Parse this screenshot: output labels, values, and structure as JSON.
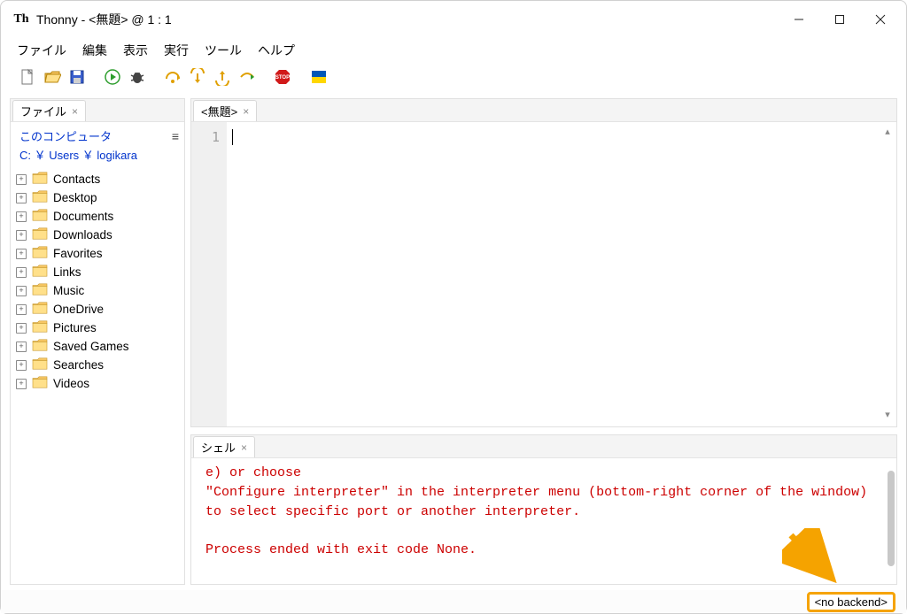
{
  "window": {
    "title": "Thonny  -  <無題>  @  1 : 1",
    "app_icon_label": "Th"
  },
  "menubar": [
    "ファイル",
    "編集",
    "表示",
    "実行",
    "ツール",
    "ヘルプ"
  ],
  "sidebar": {
    "tab_label": "ファイル",
    "computer_label": "このコンピュータ",
    "path": "C: ￥ Users ￥ logikara",
    "folders": [
      "Contacts",
      "Desktop",
      "Documents",
      "Downloads",
      "Favorites",
      "Links",
      "Music",
      "OneDrive",
      "Pictures",
      "Saved Games",
      "Searches",
      "Videos"
    ]
  },
  "editor": {
    "tab_label": "<無題>",
    "line_number": "1"
  },
  "shell": {
    "tab_label": "シェル",
    "lines": [
      "e) or choose",
      "\"Configure interpreter\" in the interpreter menu (bottom-right corner of the window)",
      "to select specific port or another interpreter.",
      "",
      "Process ended with exit code None."
    ]
  },
  "status": {
    "backend": "<no backend>"
  }
}
